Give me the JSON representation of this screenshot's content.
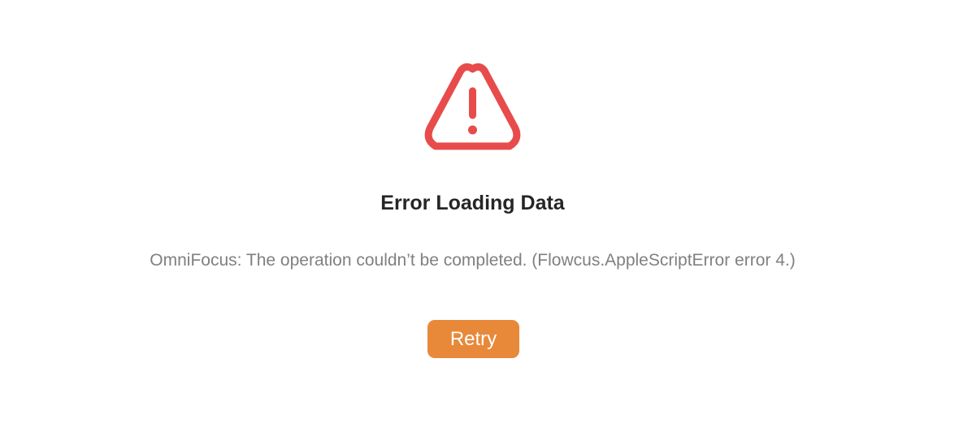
{
  "error": {
    "icon": "warning-triangle-icon",
    "icon_color": "#e84b4b",
    "title": "Error Loading Data",
    "message": "OmniFocus: The operation couldn’t be completed. (Flowcus.AppleScriptError error 4.)",
    "retry_label": "Retry",
    "retry_color": "#e8893a"
  }
}
